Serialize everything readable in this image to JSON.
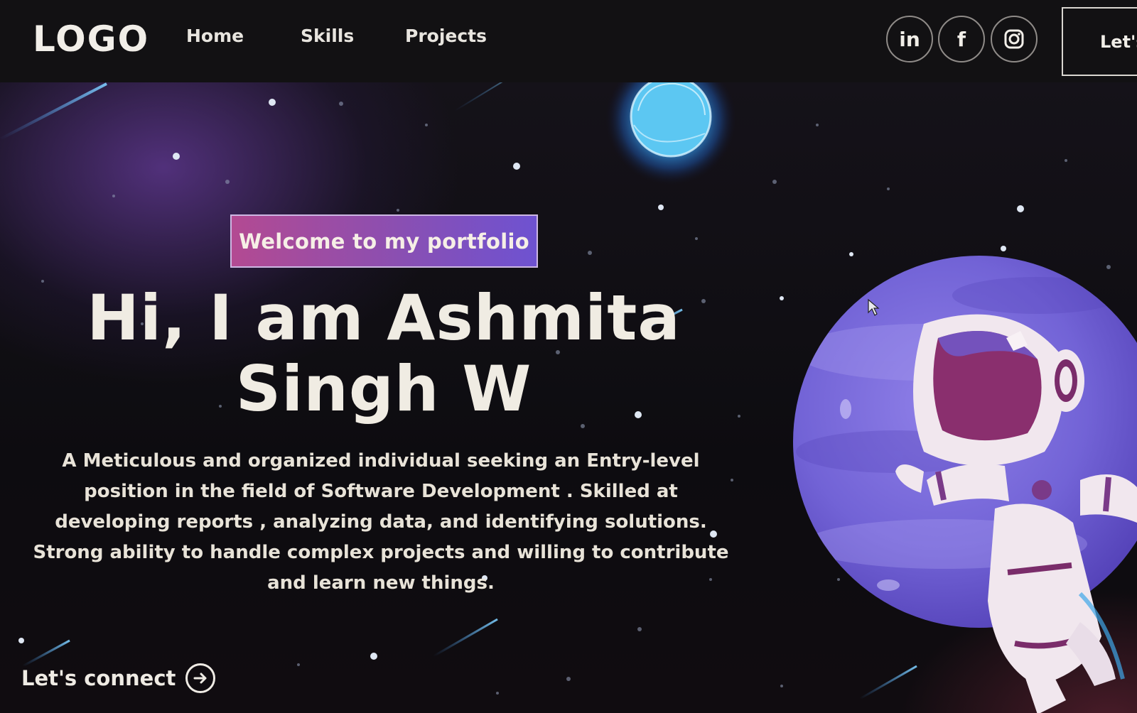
{
  "navbar": {
    "logo": "LOGO",
    "links": [
      "Home",
      "Skills",
      "Projects"
    ],
    "social": [
      {
        "name": "linkedin",
        "icon": "linkedin-icon",
        "text": "in"
      },
      {
        "name": "facebook",
        "icon": "facebook-icon",
        "text": "f"
      },
      {
        "name": "instagram",
        "icon": "instagram-icon"
      }
    ],
    "connect_button": "Let's"
  },
  "hero": {
    "badge": "Welcome to my portfolio",
    "headline_line1": "Hi, I am Ashmita",
    "headline_line2": "Singh W",
    "description": [
      "A Meticulous and organized individual seeking an Entry-level",
      "position in the field of Software Development . Skilled at",
      "developing reports , analyzing data, and identifying solutions.",
      "Strong ability to handle complex projects and willing to contribute",
      "and learn new things."
    ],
    "cta": "Let's connect",
    "cta_icon": "arrow-right-circle-icon",
    "illustration": "astronaut-on-planet-illustration",
    "moon": "blue-moon-illustration"
  },
  "colors": {
    "background": "#0d0c10",
    "navbar": "#121113",
    "badge_start": "#b34a92",
    "badge_end": "#6e52d1",
    "planet": "#7b66d8",
    "moon": "#4fb8ec",
    "text": "#f0ece3"
  }
}
